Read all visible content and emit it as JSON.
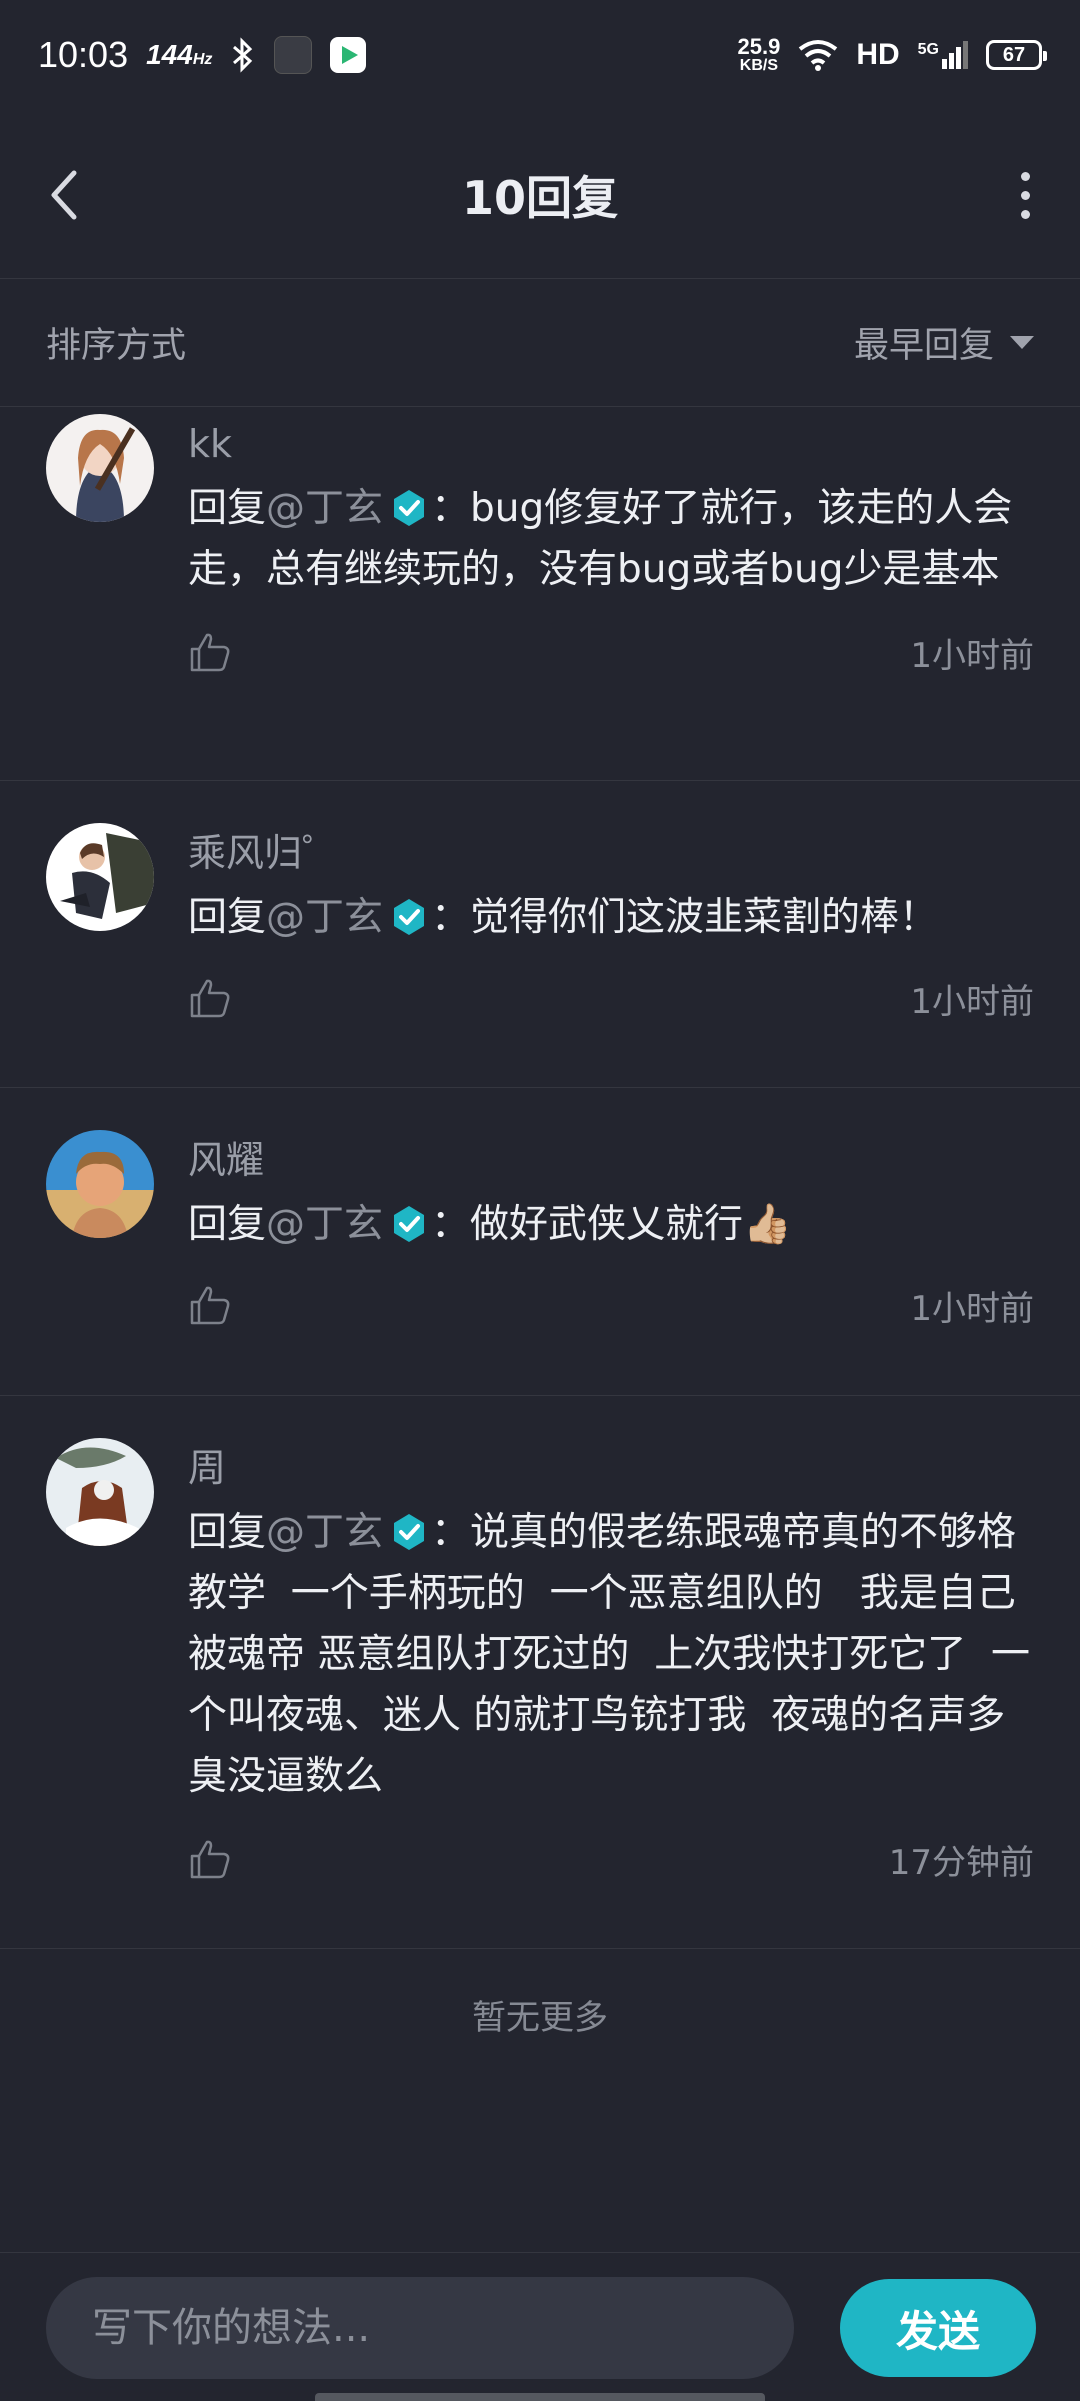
{
  "status_bar": {
    "time": "10:03",
    "refresh_rate": "144",
    "refresh_unit": "Hz",
    "net_speed_value": "25.9",
    "net_speed_unit": "KB/S",
    "hd": "HD",
    "network": "5G",
    "battery": "67"
  },
  "header": {
    "title": "10回复"
  },
  "sort": {
    "label": "排序方式",
    "selected": "最早回复"
  },
  "comments": [
    {
      "username": "kk",
      "reply_prefix": "回复",
      "mention": "@丁玄",
      "text": "：bug修复好了就行，该走的人会走，总有继续玩的，没有bug或者bug少是基本",
      "time": "1小时前"
    },
    {
      "username": "乘风归゜",
      "reply_prefix": "回复",
      "mention": "@丁玄",
      "text": "：觉得你们这波韭菜割的棒！",
      "time": "1小时前"
    },
    {
      "username": "风耀",
      "reply_prefix": "回复",
      "mention": "@丁玄",
      "text": "：做好武侠乂就行👍🏼",
      "time": "1小时前"
    },
    {
      "username": "周",
      "reply_prefix": "回复",
      "mention": "@丁玄",
      "text": "：说真的假老练跟魂帝真的不够格教学  一个手柄玩的  一个恶意组队的   我是自己被魂帝 恶意组队打死过的  上次我快打死它了  一个叫夜魂、迷人 的就打鸟铳打我  夜魂的名声多臭没逼数么",
      "time": "17分钟前"
    }
  ],
  "footer": {
    "no_more": "暂无更多"
  },
  "input": {
    "placeholder": "写下你的想法...",
    "send_label": "发送"
  },
  "colors": {
    "accent": "#1fb6c5",
    "background": "#23252f",
    "badge": "#1fb6c5"
  }
}
